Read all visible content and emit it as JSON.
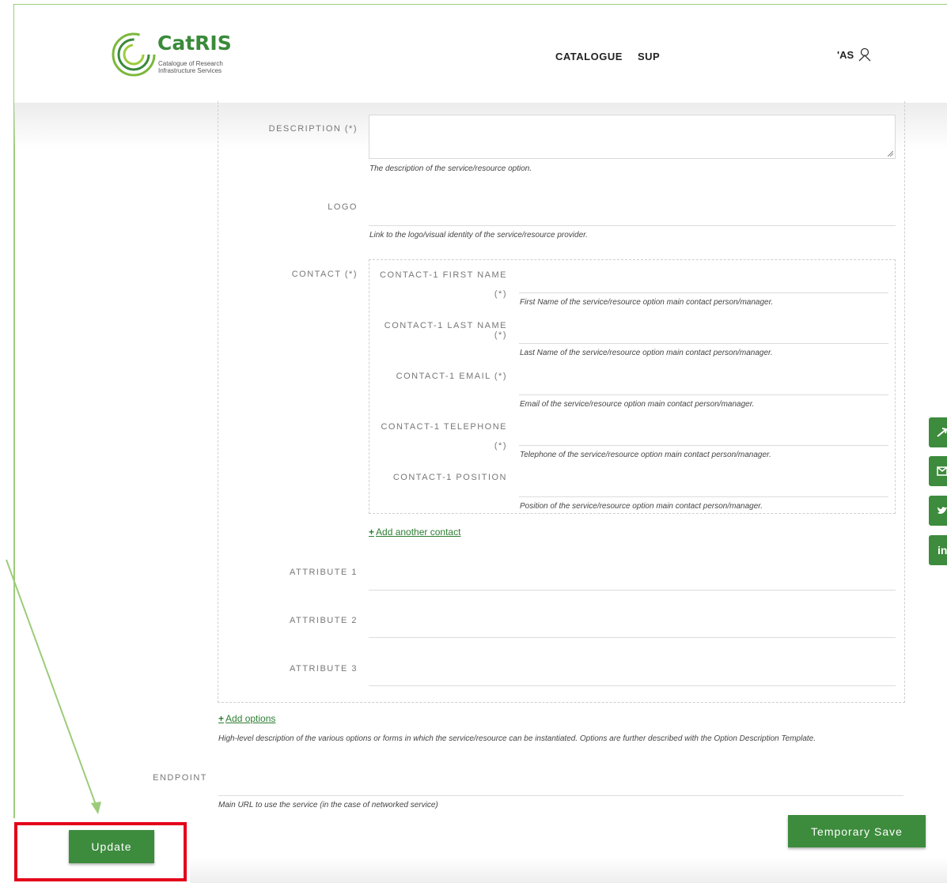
{
  "header": {
    "logo_title": "CatRIS",
    "logo_subtitle": "Catalogue of Research Infrastructure Services",
    "nav": [
      "CATALOGUE",
      "SUP"
    ],
    "user_label": "'AS"
  },
  "form": {
    "description": {
      "label": "DESCRIPTION (*)",
      "help": "The description of the service/resource option."
    },
    "logo": {
      "label": "LOGO",
      "help": "Link to the logo/visual identity of the service/resource provider."
    },
    "contact": {
      "label": "CONTACT (*)",
      "first_name": {
        "label_line1": "CONTACT-1 FIRST NAME",
        "label_line2": "(*)",
        "help": "First Name of the service/resource option main contact person/manager."
      },
      "last_name": {
        "label": "CONTACT-1 LAST NAME (*)",
        "help": "Last Name of the service/resource option main contact person/manager."
      },
      "email": {
        "label": "CONTACT-1 EMAIL (*)",
        "help": "Email of the service/resource option main contact person/manager."
      },
      "telephone": {
        "label_line1": "CONTACT-1 TELEPHONE",
        "label_line2": "(*)",
        "help": "Telephone of the service/resource option main contact person/manager."
      },
      "position": {
        "label": "CONTACT-1 POSITION",
        "help": "Position of the service/resource option main contact person/manager."
      },
      "add_contact": "Add another contact"
    },
    "attribute1": "ATTRIBUTE 1",
    "attribute2": "ATTRIBUTE 2",
    "attribute3": "ATTRIBUTE 3",
    "add_options": "Add options",
    "options_help": "High-level description of the various options or forms in which the service/resource can be instantiated. Options are further described with the Option Description Template.",
    "endpoint": {
      "label": "ENDPOINT",
      "help": "Main URL to use the service (in the case of networked service)"
    }
  },
  "buttons": {
    "update": "Update",
    "temporary_save": "Temporary Save"
  },
  "social": [
    "share-icon",
    "mail-icon",
    "twitter-icon",
    "linkedin-icon"
  ],
  "colors": {
    "accent": "#3d8b3d",
    "highlight": "#e4001b"
  }
}
